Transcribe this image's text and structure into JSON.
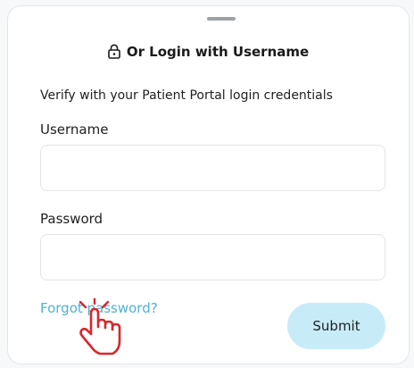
{
  "header": {
    "title": "Or Login with Username",
    "icon": "lock-icon"
  },
  "form": {
    "subtitle": "Verify with your Patient Portal login credentials",
    "username_label": "Username",
    "username_value": "",
    "password_label": "Password",
    "password_value": "",
    "forgot_label": "Forgot password?",
    "submit_label": "Submit"
  },
  "colors": {
    "link": "#4fb3cf",
    "submit_bg": "#c7ecf7",
    "cursor_stroke": "#d9262c"
  }
}
